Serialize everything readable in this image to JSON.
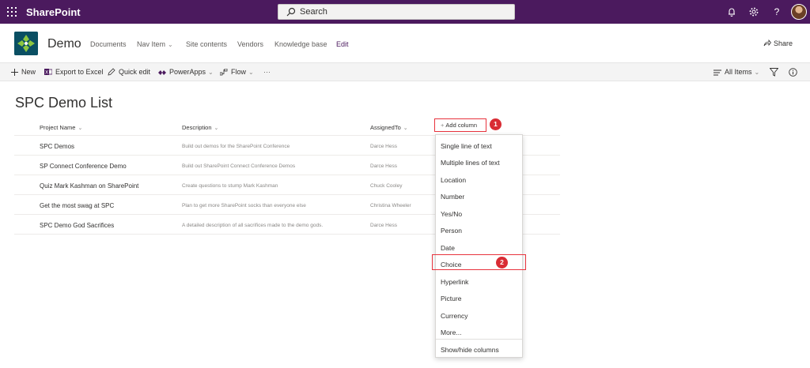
{
  "suite": {
    "brand": "SharePoint",
    "search_placeholder": "Search",
    "icons": [
      "waffle-icon",
      "bell-icon",
      "gear-icon",
      "help-icon",
      "avatar"
    ]
  },
  "site": {
    "title": "Demo",
    "nav": [
      "Documents",
      "Nav Item",
      "Site contents",
      "Vendors",
      "Knowledge base",
      "Edit"
    ],
    "share": "Share"
  },
  "commands": {
    "new": "New",
    "export": "Export to Excel",
    "quick_edit": "Quick edit",
    "powerapps": "PowerApps",
    "flow": "Flow",
    "more": "···",
    "view": "All Items"
  },
  "list": {
    "title": "SPC Demo List",
    "columns": [
      "Project Name",
      "Description",
      "AssignedTo"
    ],
    "add_column": "Add column",
    "rows": [
      {
        "name": "SPC Demos",
        "desc": "Build out demos for the SharePoint Conference",
        "assigned": "Darce Hess"
      },
      {
        "name": "SP Connect Conference Demo",
        "desc": "Build out SharePoint Connect Conference Demos",
        "assigned": "Darce Hess"
      },
      {
        "name": "Quiz Mark Kashman on SharePoint",
        "desc": "Create questions to stump Mark Kashman",
        "assigned": "Chuck Cooley"
      },
      {
        "name": "Get the most swag at SPC",
        "desc": "Plan to get more SharePoint socks than everyone else",
        "assigned": "Christina Wheeler"
      },
      {
        "name": "SPC Demo God Sacrifices",
        "desc": "A detailed description of all sacrifices made to the demo gods.",
        "assigned": "Darce Hess"
      }
    ]
  },
  "menu": {
    "items": [
      "Single line of text",
      "Multiple lines of text",
      "Location",
      "Number",
      "Yes/No",
      "Person",
      "Date",
      "Choice",
      "Hyperlink",
      "Picture",
      "Currency",
      "More...",
      "Show/hide columns"
    ]
  },
  "callouts": [
    "1",
    "2"
  ],
  "colors": {
    "suite": "#4b1a5e",
    "callout": "#d92c34"
  }
}
